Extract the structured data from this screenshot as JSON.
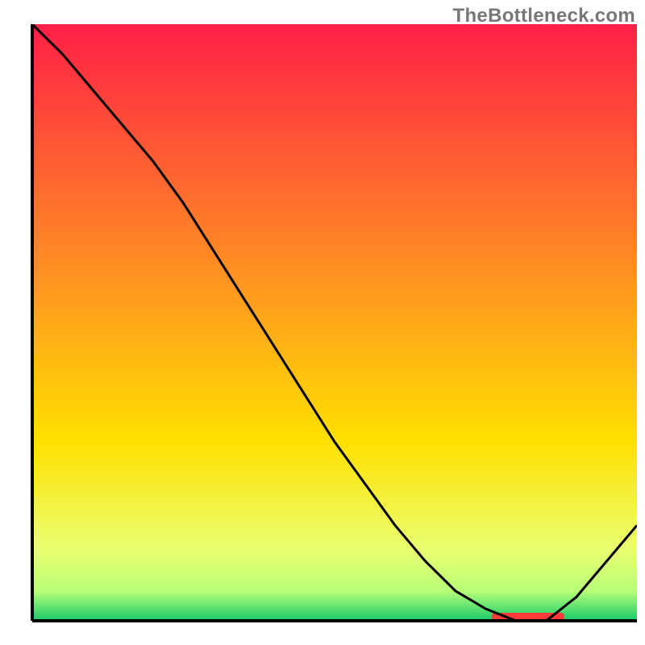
{
  "watermark": "TheBottleneck.com",
  "chart_data": {
    "type": "line",
    "title": "",
    "xlabel": "",
    "ylabel": "",
    "xlim": [
      0,
      100
    ],
    "ylim": [
      0,
      100
    ],
    "x": [
      0,
      5,
      10,
      15,
      20,
      25,
      30,
      35,
      40,
      45,
      50,
      55,
      60,
      65,
      70,
      75,
      80,
      85,
      90,
      95,
      100
    ],
    "values": [
      100,
      95,
      89,
      83,
      77,
      70,
      62,
      54,
      46,
      38,
      30,
      23,
      16,
      10,
      5,
      2,
      0,
      0,
      4,
      10,
      16
    ],
    "background_gradient": {
      "top": "#ff1f47",
      "mid": "#ffe100",
      "bottom_band": "#eaff70",
      "base": "#18c96b"
    },
    "axis_color": "#000000",
    "curve_color": "#000000",
    "marker": {
      "x_start": 76,
      "x_end": 88,
      "color": "#ff3a3a"
    }
  }
}
